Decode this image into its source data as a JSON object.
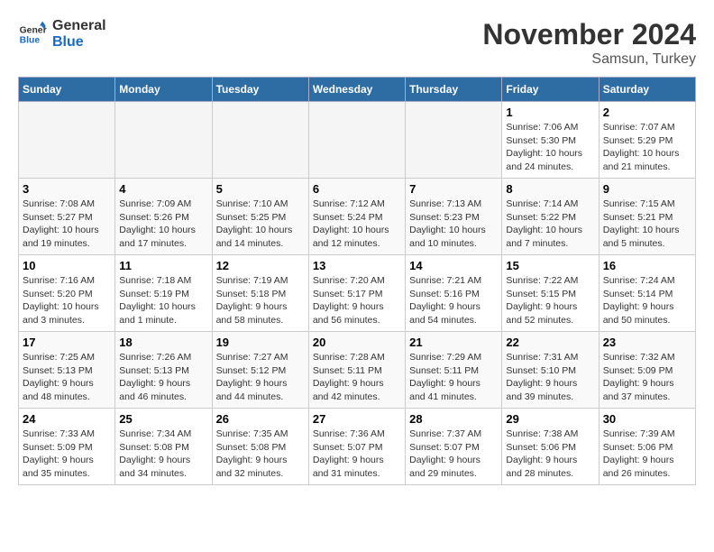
{
  "header": {
    "logo_line1": "General",
    "logo_line2": "Blue",
    "month": "November 2024",
    "location": "Samsun, Turkey"
  },
  "weekdays": [
    "Sunday",
    "Monday",
    "Tuesday",
    "Wednesday",
    "Thursday",
    "Friday",
    "Saturday"
  ],
  "weeks": [
    [
      {
        "day": "",
        "info": ""
      },
      {
        "day": "",
        "info": ""
      },
      {
        "day": "",
        "info": ""
      },
      {
        "day": "",
        "info": ""
      },
      {
        "day": "",
        "info": ""
      },
      {
        "day": "1",
        "info": "Sunrise: 7:06 AM\nSunset: 5:30 PM\nDaylight: 10 hours and 24 minutes."
      },
      {
        "day": "2",
        "info": "Sunrise: 7:07 AM\nSunset: 5:29 PM\nDaylight: 10 hours and 21 minutes."
      }
    ],
    [
      {
        "day": "3",
        "info": "Sunrise: 7:08 AM\nSunset: 5:27 PM\nDaylight: 10 hours and 19 minutes."
      },
      {
        "day": "4",
        "info": "Sunrise: 7:09 AM\nSunset: 5:26 PM\nDaylight: 10 hours and 17 minutes."
      },
      {
        "day": "5",
        "info": "Sunrise: 7:10 AM\nSunset: 5:25 PM\nDaylight: 10 hours and 14 minutes."
      },
      {
        "day": "6",
        "info": "Sunrise: 7:12 AM\nSunset: 5:24 PM\nDaylight: 10 hours and 12 minutes."
      },
      {
        "day": "7",
        "info": "Sunrise: 7:13 AM\nSunset: 5:23 PM\nDaylight: 10 hours and 10 minutes."
      },
      {
        "day": "8",
        "info": "Sunrise: 7:14 AM\nSunset: 5:22 PM\nDaylight: 10 hours and 7 minutes."
      },
      {
        "day": "9",
        "info": "Sunrise: 7:15 AM\nSunset: 5:21 PM\nDaylight: 10 hours and 5 minutes."
      }
    ],
    [
      {
        "day": "10",
        "info": "Sunrise: 7:16 AM\nSunset: 5:20 PM\nDaylight: 10 hours and 3 minutes."
      },
      {
        "day": "11",
        "info": "Sunrise: 7:18 AM\nSunset: 5:19 PM\nDaylight: 10 hours and 1 minute."
      },
      {
        "day": "12",
        "info": "Sunrise: 7:19 AM\nSunset: 5:18 PM\nDaylight: 9 hours and 58 minutes."
      },
      {
        "day": "13",
        "info": "Sunrise: 7:20 AM\nSunset: 5:17 PM\nDaylight: 9 hours and 56 minutes."
      },
      {
        "day": "14",
        "info": "Sunrise: 7:21 AM\nSunset: 5:16 PM\nDaylight: 9 hours and 54 minutes."
      },
      {
        "day": "15",
        "info": "Sunrise: 7:22 AM\nSunset: 5:15 PM\nDaylight: 9 hours and 52 minutes."
      },
      {
        "day": "16",
        "info": "Sunrise: 7:24 AM\nSunset: 5:14 PM\nDaylight: 9 hours and 50 minutes."
      }
    ],
    [
      {
        "day": "17",
        "info": "Sunrise: 7:25 AM\nSunset: 5:13 PM\nDaylight: 9 hours and 48 minutes."
      },
      {
        "day": "18",
        "info": "Sunrise: 7:26 AM\nSunset: 5:13 PM\nDaylight: 9 hours and 46 minutes."
      },
      {
        "day": "19",
        "info": "Sunrise: 7:27 AM\nSunset: 5:12 PM\nDaylight: 9 hours and 44 minutes."
      },
      {
        "day": "20",
        "info": "Sunrise: 7:28 AM\nSunset: 5:11 PM\nDaylight: 9 hours and 42 minutes."
      },
      {
        "day": "21",
        "info": "Sunrise: 7:29 AM\nSunset: 5:11 PM\nDaylight: 9 hours and 41 minutes."
      },
      {
        "day": "22",
        "info": "Sunrise: 7:31 AM\nSunset: 5:10 PM\nDaylight: 9 hours and 39 minutes."
      },
      {
        "day": "23",
        "info": "Sunrise: 7:32 AM\nSunset: 5:09 PM\nDaylight: 9 hours and 37 minutes."
      }
    ],
    [
      {
        "day": "24",
        "info": "Sunrise: 7:33 AM\nSunset: 5:09 PM\nDaylight: 9 hours and 35 minutes."
      },
      {
        "day": "25",
        "info": "Sunrise: 7:34 AM\nSunset: 5:08 PM\nDaylight: 9 hours and 34 minutes."
      },
      {
        "day": "26",
        "info": "Sunrise: 7:35 AM\nSunset: 5:08 PM\nDaylight: 9 hours and 32 minutes."
      },
      {
        "day": "27",
        "info": "Sunrise: 7:36 AM\nSunset: 5:07 PM\nDaylight: 9 hours and 31 minutes."
      },
      {
        "day": "28",
        "info": "Sunrise: 7:37 AM\nSunset: 5:07 PM\nDaylight: 9 hours and 29 minutes."
      },
      {
        "day": "29",
        "info": "Sunrise: 7:38 AM\nSunset: 5:06 PM\nDaylight: 9 hours and 28 minutes."
      },
      {
        "day": "30",
        "info": "Sunrise: 7:39 AM\nSunset: 5:06 PM\nDaylight: 9 hours and 26 minutes."
      }
    ]
  ]
}
